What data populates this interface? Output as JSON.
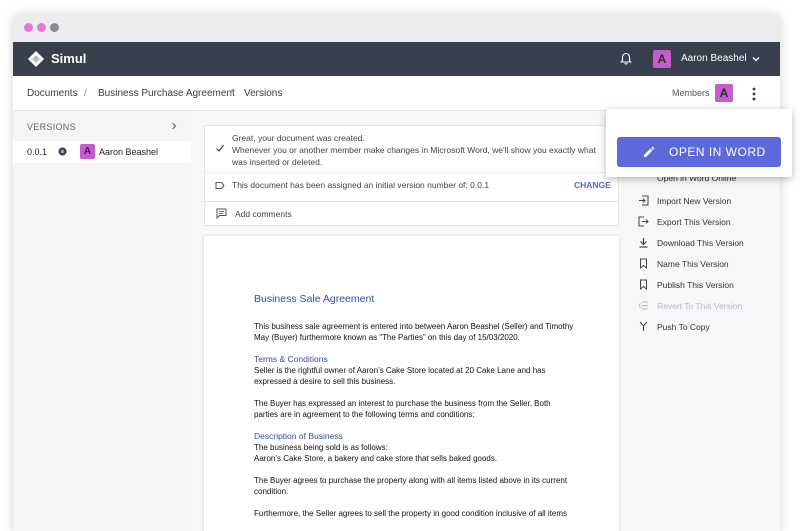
{
  "colors": {
    "dot_1": "#e678d2",
    "dot_2": "#e678d2",
    "dot_3": "#8a8a8f",
    "topbar": "#3a3f4d",
    "accent": "#5e68dd",
    "avatar": "#c75bd0"
  },
  "app": {
    "brand": "Simul"
  },
  "user": {
    "name": "Aaron Beashel",
    "initial": "A"
  },
  "breadcrumb": [
    "Documents",
    "Business Purchase Agreement",
    "Versions"
  ],
  "breadcrumb_sep": "/",
  "members": {
    "label": "Members",
    "initial": "A"
  },
  "sidebar": {
    "heading": "VERSIONS",
    "versions": [
      {
        "number": "0.0.1",
        "author": "Aaron Beashel",
        "initial": "A"
      }
    ]
  },
  "notice": {
    "line1": "Great, your document was created.",
    "line2": "Whenever you or another member make changes in Microsoft Word, we'll show you exactly what was inserted or deleted.",
    "version_text": "This document has been assigned an initial version number of: 0.0.1",
    "change_label": "CHANGE"
  },
  "comments": {
    "label": "Add comments"
  },
  "document": {
    "title": "Business Sale Agreement",
    "intro": "This business sale agreement is entered into between Aaron Beashel (Seller) and Timothy May (Buyer) furthermore known as “The Parties”  on this day of 15/03/2020.",
    "heading1": "Terms & Conditions",
    "para1": "Seller is the rightful owner of Aaron’s Cake Store located at 20 Cake Lane and has expressed a desire to sell this business.",
    "para2": "The Buyer has expressed an interest to purchase the business from the Seller. Both parties are in agreement to the following terms and conditions:",
    "heading2": "Description of Business",
    "para3a": "The business being sold is as follows:",
    "para3b": "Aaron’s Cake Store, a bakery and cake store that sells baked goods.",
    "para4": "The Buyer agrees to purchase the property along with all items listed above in its current condition.",
    "para5": "Furthermore, the Seller agrees to sell the property in good condition inclusive of all items"
  },
  "open_word": {
    "label": "OPEN IN WORD"
  },
  "actions": [
    {
      "label": "Open in Word Online",
      "icon": "globe-icon",
      "enabled": true
    },
    {
      "label": "Import New Version",
      "icon": "import-icon",
      "enabled": true
    },
    {
      "label": "Export This Version",
      "icon": "export-icon",
      "enabled": true
    },
    {
      "label": "Download This Version",
      "icon": "download-icon",
      "enabled": true
    },
    {
      "label": "Name This Version",
      "icon": "bookmark-icon",
      "enabled": true
    },
    {
      "label": "Publish This Version",
      "icon": "bookmark-outline-icon",
      "enabled": true
    },
    {
      "label": "Revert To This Version",
      "icon": "revert-icon",
      "enabled": false
    },
    {
      "label": "Push To Copy",
      "icon": "merge-icon",
      "enabled": true
    }
  ]
}
